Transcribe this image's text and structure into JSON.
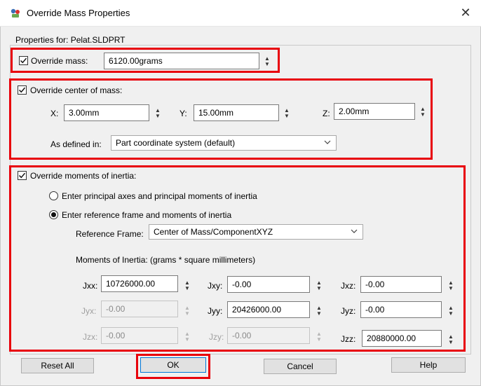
{
  "window": {
    "title": "Override Mass Properties",
    "close_glyph": "✕"
  },
  "properties_for": "Properties for: Pelat.SLDPRT",
  "mass": {
    "label": "Override mass:",
    "value": "6120.00grams",
    "checked": true
  },
  "center_of_mass": {
    "label": "Override center of mass:",
    "x": {
      "label": "X:",
      "value": "3.00mm"
    },
    "y": {
      "label": "Y:",
      "value": "15.00mm"
    },
    "z": {
      "label": "Z:",
      "value": "2.00mm"
    },
    "defined_in_label": "As defined in:",
    "defined_in_value": "Part coordinate system (default)"
  },
  "moments": {
    "label": "Override moments of inertia:",
    "option_principal": "Enter principal axes and principal moments of inertia",
    "option_reference": "Enter reference frame and moments of inertia",
    "reference_frame_label": "Reference Frame:",
    "reference_frame_value": "Center of Mass/ComponentXYZ",
    "units_label": "Moments of Inertia: (grams *  square millimeters)",
    "jxx": {
      "label": "Jxx:",
      "value": "10726000.00"
    },
    "jxy": {
      "label": "Jxy:",
      "value": "-0.00"
    },
    "jxz": {
      "label": "Jxz:",
      "value": "-0.00"
    },
    "jyx": {
      "label": "Jyx:",
      "value": "-0.00"
    },
    "jyy": {
      "label": "Jyy:",
      "value": "20426000.00"
    },
    "jyz": {
      "label": "Jyz:",
      "value": "-0.00"
    },
    "jzx": {
      "label": "Jzx:",
      "value": "-0.00"
    },
    "jzy": {
      "label": "Jzy:",
      "value": "-0.00"
    },
    "jzz": {
      "label": "Jzz:",
      "value": "20880000.00"
    }
  },
  "buttons": {
    "reset_all": "Reset All",
    "ok": "OK",
    "cancel": "Cancel",
    "help": "Help"
  },
  "colors": {
    "highlight": "#e8000b",
    "dialog_bg": "#f0f0f0"
  },
  "icons": {
    "app": "solidworks-mass-properties-icon",
    "spin_up": "▲",
    "spin_down": "▼"
  }
}
